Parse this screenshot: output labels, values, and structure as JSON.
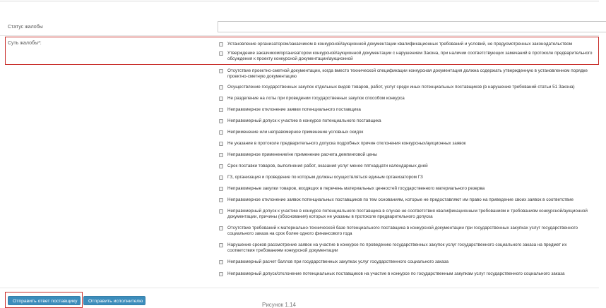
{
  "form": {
    "status_label": "Статус жалобы",
    "status_value": "",
    "essence_label": "Суть жалобы*:"
  },
  "options": [
    "Установление организатором/заказчиком в конкурсной/аукционной документации квалификационных требований и условий, не предусмотренных законодательством",
    "Утверждение заказчиком/организатором конкурсной/аукционной документации с нарушением Закона, при наличии соответствующих замечаний в протоколе предварительного обсуждения к проекту конкурсной документации/аукционной",
    "Отсутствие проектно-сметной документации, когда вместо технической спецификации конкурсная документация должна содержать утвержденную в установленном порядке проектно-сметную документацию",
    "Осуществление государственных закупок отдельных видов товаров, работ, услуг среди иных потенциальных поставщиков (в нарушение требований статьи 51 Закона)",
    "Не разделение на лоты при проведении государственных закупок способом конкурса",
    "Неправомерное отклонение заявки потенциального поставщика",
    "Неправомерный допуск к участию в конкурсе потенциального поставщика",
    "Неприменение или неправомерное применение условных скидок",
    "Не указание в протоколе предварительного допуска подробных причин отклонения конкурсных/аукционных заявок",
    "Неправомерное применение/не применение расчета демпинговой цены",
    "Срок поставки товаров, выполнения работ, оказания услуг менее пятнадцати календарных дней",
    "ГЗ, организация и проведение по которым должны осуществляться единым организатором ГЗ",
    "Неправомерные закупки товаров, входящих в перечень материальных ценностей государственного материального резерва",
    "Неправомерное отклонение заявок потенциальных поставщиков по тем основаниям, которые не предоставляют им право на приведение своих заявок в соответствие",
    "Неправомерный допуск к участию в конкурсе потенциального поставщика в случае не соответствия квалификационным требованиям и требованиям конкурсной/аукционной документации, причины (обоснования) которых не указаны в протоколе предварительного допуска",
    "Отсутствие требований к материально-технической базе потенциального поставщика в конкурсной документации при государственных закупках услуг государственного социального заказа на срок более одного финансового года",
    "Нарушение сроков рассмотрение заявок на участие в конкурсе по проведению государственных закупок услуг государственного социального заказа на предмет их соответствия требованиям конкурсной документации",
    "Неправомерный расчет баллов при государственных закупках услуг государственного социального заказа",
    "Неправомерный допуск/отклонение потенциальных поставщиков на участие в конкурсе по государственным закупкам услуг государственного социального заказа"
  ],
  "buttons": {
    "reply_supplier": "Отправить ответ поставщику",
    "send_executor": "Отправить исполнителю"
  },
  "caption": "Рисунок 1.14"
}
